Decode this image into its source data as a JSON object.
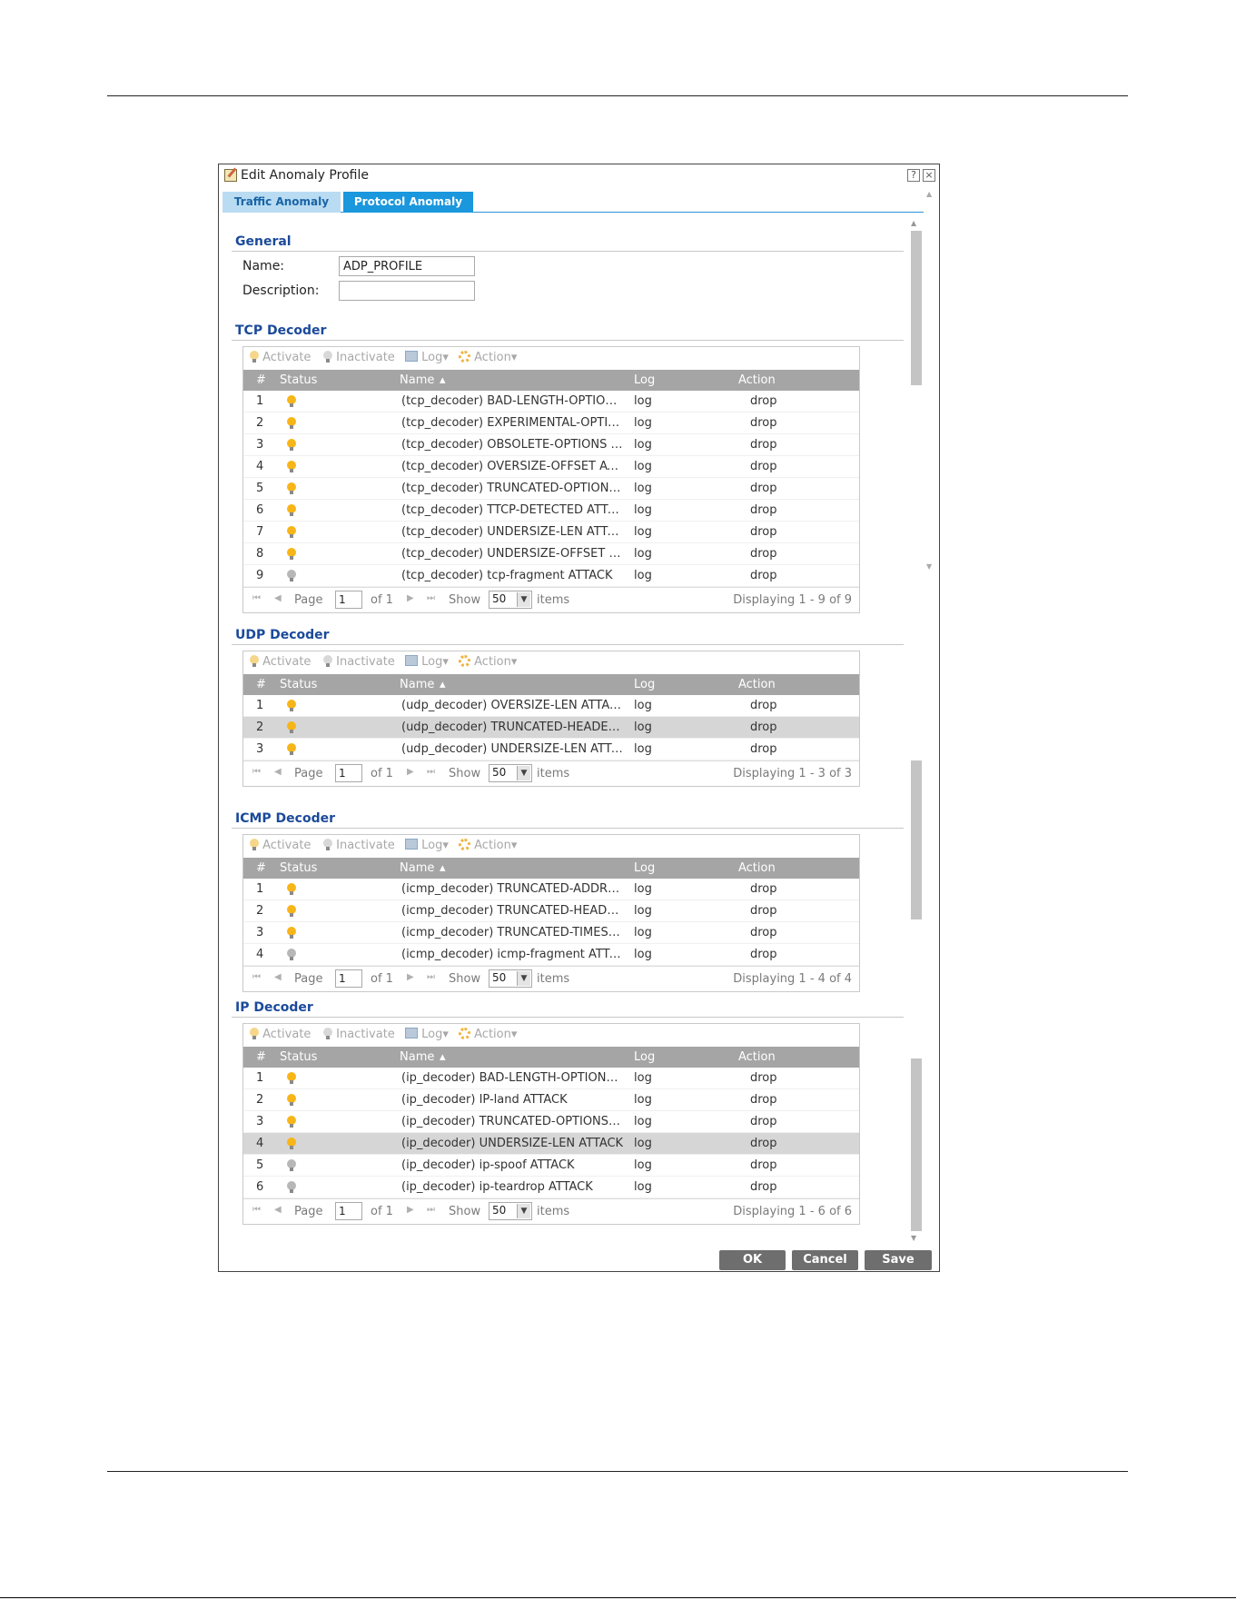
{
  "dialog": {
    "title": "Edit Anomaly Profile",
    "help_label": "?",
    "close_label": "×",
    "tabs": [
      {
        "label": "Traffic Anomaly",
        "active": false
      },
      {
        "label": "Protocol Anomaly",
        "active": true
      }
    ]
  },
  "general": {
    "title": "General",
    "name_label": "Name:",
    "name_value": "ADP_PROFILE",
    "description_label": "Description:",
    "description_value": ""
  },
  "toolbar": {
    "activate": "Activate",
    "inactivate": "Inactivate",
    "log": "Log",
    "action": "Action"
  },
  "columns": {
    "num": "#",
    "status": "Status",
    "name": "Name",
    "log": "Log",
    "action": "Action"
  },
  "pager": {
    "page_label": "Page",
    "page_value": "1",
    "of_label": "of 1",
    "show_label": "Show",
    "show_value": "50",
    "items_label": "items"
  },
  "sections": {
    "tcp": {
      "title": "TCP Decoder",
      "displaying": "Displaying 1 - 9 of 9",
      "rows": [
        {
          "num": "1",
          "status": "active",
          "name": "(tcp_decoder) BAD-LENGTH-OPTIONS ATTACK",
          "log": "log",
          "action": "drop"
        },
        {
          "num": "2",
          "status": "active",
          "name": "(tcp_decoder) EXPERIMENTAL-OPTIONS ATTACK",
          "log": "log",
          "action": "drop"
        },
        {
          "num": "3",
          "status": "active",
          "name": "(tcp_decoder) OBSOLETE-OPTIONS ATTACK",
          "log": "log",
          "action": "drop"
        },
        {
          "num": "4",
          "status": "active",
          "name": "(tcp_decoder) OVERSIZE-OFFSET ATTACK",
          "log": "log",
          "action": "drop"
        },
        {
          "num": "5",
          "status": "active",
          "name": "(tcp_decoder) TRUNCATED-OPTIONS ATTACK",
          "log": "log",
          "action": "drop"
        },
        {
          "num": "6",
          "status": "active",
          "name": "(tcp_decoder) TTCP-DETECTED ATTACK",
          "log": "log",
          "action": "drop"
        },
        {
          "num": "7",
          "status": "active",
          "name": "(tcp_decoder) UNDERSIZE-LEN ATTACK",
          "log": "log",
          "action": "drop"
        },
        {
          "num": "8",
          "status": "active",
          "name": "(tcp_decoder) UNDERSIZE-OFFSET ATTACK",
          "log": "log",
          "action": "drop"
        },
        {
          "num": "9",
          "status": "inactive",
          "name": "(tcp_decoder) tcp-fragment ATTACK",
          "log": "log",
          "action": "drop"
        }
      ]
    },
    "udp": {
      "title": "UDP Decoder",
      "displaying": "Displaying 1 - 3 of 3",
      "rows": [
        {
          "num": "1",
          "status": "active",
          "name": "(udp_decoder) OVERSIZE-LEN ATTACK",
          "log": "log",
          "action": "drop"
        },
        {
          "num": "2",
          "status": "active",
          "name": "(udp_decoder) TRUNCATED-HEADER ATTACK",
          "log": "log",
          "action": "drop",
          "selected": true
        },
        {
          "num": "3",
          "status": "active",
          "name": "(udp_decoder) UNDERSIZE-LEN ATTACK",
          "log": "log",
          "action": "drop"
        }
      ]
    },
    "icmp": {
      "title": "ICMP Decoder",
      "displaying": "Displaying 1 - 4 of 4",
      "rows": [
        {
          "num": "1",
          "status": "active",
          "name": "(icmp_decoder) TRUNCATED-ADDRESS-HEADER ATTACK",
          "log": "log",
          "action": "drop"
        },
        {
          "num": "2",
          "status": "active",
          "name": "(icmp_decoder) TRUNCATED-HEADER ATTACK",
          "log": "log",
          "action": "drop"
        },
        {
          "num": "3",
          "status": "active",
          "name": "(icmp_decoder) TRUNCATED-TIMESTAMP-HEADER ATTACK",
          "log": "log",
          "action": "drop"
        },
        {
          "num": "4",
          "status": "inactive",
          "name": "(icmp_decoder) icmp-fragment ATTACK",
          "log": "log",
          "action": "drop"
        }
      ]
    },
    "ip": {
      "title": "IP Decoder",
      "displaying": "Displaying 1 - 6 of 6",
      "rows": [
        {
          "num": "1",
          "status": "active",
          "name": "(ip_decoder) BAD-LENGTH-OPTIONS ATTACK",
          "log": "log",
          "action": "drop"
        },
        {
          "num": "2",
          "status": "active",
          "name": "(ip_decoder) IP-land ATTACK",
          "log": "log",
          "action": "drop"
        },
        {
          "num": "3",
          "status": "active",
          "name": "(ip_decoder) TRUNCATED-OPTIONS ATTACK",
          "log": "log",
          "action": "drop"
        },
        {
          "num": "4",
          "status": "active",
          "name": "(ip_decoder) UNDERSIZE-LEN ATTACK",
          "log": "log",
          "action": "drop",
          "selected": true
        },
        {
          "num": "5",
          "status": "inactive",
          "name": "(ip_decoder) ip-spoof ATTACK",
          "log": "log",
          "action": "drop"
        },
        {
          "num": "6",
          "status": "inactive",
          "name": "(ip_decoder) ip-teardrop ATTACK",
          "log": "log",
          "action": "drop"
        }
      ]
    }
  },
  "buttons": {
    "ok": "OK",
    "cancel": "Cancel",
    "save": "Save"
  },
  "colors": {
    "section_title": "#1b4a9a",
    "active_tab": "#1a97dd",
    "grid_header": "#a5a5a5",
    "button": "#6e6e6e"
  }
}
